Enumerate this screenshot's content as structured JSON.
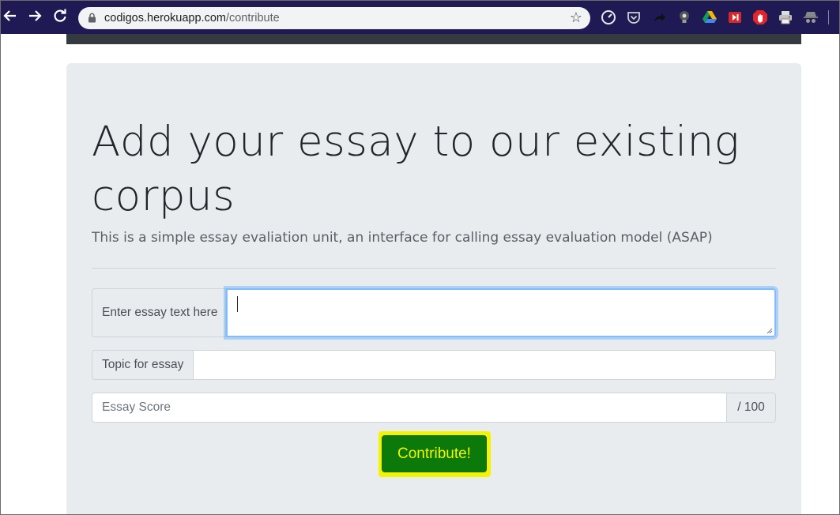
{
  "browser": {
    "url_host": "codigos.herokuapp.com",
    "url_path": "/contribute",
    "extensions": [
      "speedometer-icon",
      "pocket-icon",
      "share-arrow-icon",
      "lightbulb-icon",
      "google-drive-icon",
      "media-icon",
      "adblock-icon",
      "printer-icon",
      "incognito-icon"
    ]
  },
  "page": {
    "title": "Add your essay to our existing corpus",
    "lead": "This is a simple essay evaliation unit, an interface for calling essay evaluation model (ASAP)"
  },
  "form": {
    "essay_label": "Enter essay text here",
    "essay_value": "",
    "topic_label": "Topic for essay",
    "topic_value": "",
    "score_placeholder": "Essay Score",
    "score_suffix": "/ 100",
    "submit_label": "Contribute!"
  },
  "colors": {
    "toolbar": "#1f1a54",
    "jumbotron": "#e9ecef",
    "button_bg": "#0b7a0b",
    "button_text": "#f4f400",
    "highlight": "#f4f400"
  }
}
